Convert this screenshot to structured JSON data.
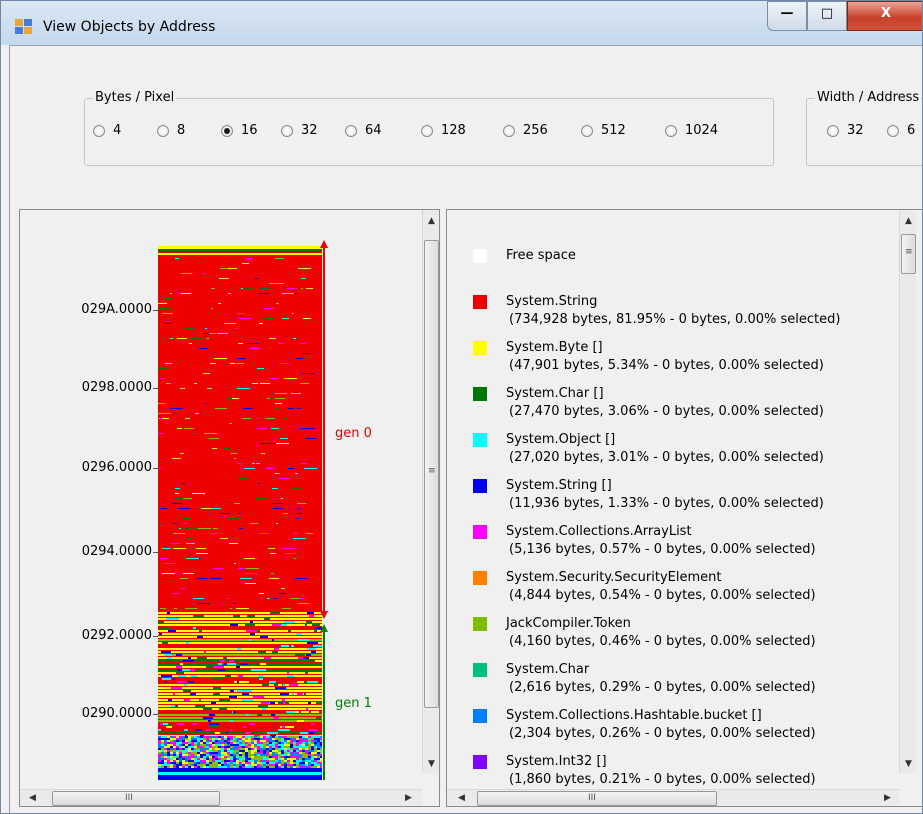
{
  "window": {
    "title": "View Objects by Address",
    "minimize": "—",
    "maximize": "□",
    "close": "X"
  },
  "bytes_per_pixel": {
    "title": "Bytes / Pixel",
    "options": [
      "4",
      "8",
      "16",
      "32",
      "64",
      "128",
      "256",
      "512",
      "1024"
    ],
    "selected": "16"
  },
  "width_address": {
    "title": "Width / Address",
    "options": [
      "32",
      "6"
    ]
  },
  "map": {
    "addresses": [
      "029A.0000",
      "0298.0000",
      "0296.0000",
      "0294.0000",
      "0292.0000",
      "0290.0000"
    ],
    "gen0": {
      "label": "gen 0",
      "color": "#ee0000"
    },
    "gen1": {
      "label": "gen 1",
      "color": "#008000"
    }
  },
  "legend": [
    {
      "name": "Free space",
      "detail": "",
      "color": "#ffffff"
    },
    {
      "name": "System.String",
      "detail": "(734,928 bytes, 81.95% - 0 bytes, 0.00% selected)",
      "color": "#ee0000"
    },
    {
      "name": "System.Byte []",
      "detail": "(47,901 bytes, 5.34% - 0 bytes, 0.00% selected)",
      "color": "#ffff00"
    },
    {
      "name": "System.Char []",
      "detail": "(27,470 bytes, 3.06% - 0 bytes, 0.00% selected)",
      "color": "#007800"
    },
    {
      "name": "System.Object []",
      "detail": "(27,020 bytes, 3.01% - 0 bytes, 0.00% selected)",
      "color": "#00ffff"
    },
    {
      "name": "System.String []",
      "detail": "(11,936 bytes, 1.33% - 0 bytes, 0.00% selected)",
      "color": "#0000ee"
    },
    {
      "name": "System.Collections.ArrayList",
      "detail": "(5,136 bytes, 0.57% - 0 bytes, 0.00% selected)",
      "color": "#ff00ff"
    },
    {
      "name": "System.Security.SecurityElement",
      "detail": "(4,844 bytes, 0.54% - 0 bytes, 0.00% selected)",
      "color": "#ff7f00"
    },
    {
      "name": "JackCompiler.Token",
      "detail": "(4,160 bytes, 0.46% - 0 bytes, 0.00% selected)",
      "color": "#7fbf00"
    },
    {
      "name": "System.Char",
      "detail": "(2,616 bytes, 0.29% - 0 bytes, 0.00% selected)",
      "color": "#00bf7f"
    },
    {
      "name": "System.Collections.Hashtable.bucket []",
      "detail": "(2,304 bytes, 0.26% - 0 bytes, 0.00% selected)",
      "color": "#007fff"
    },
    {
      "name": "System.Int32 []",
      "detail": "(1,860 bytes, 0.21% - 0 bytes, 0.00% selected)",
      "color": "#7f00ff"
    }
  ],
  "icons": {
    "window_icon": "app-window-icon",
    "scroll_up": "▲",
    "scroll_down": "▼",
    "scroll_left": "◀",
    "scroll_right": "▶",
    "grip_v": "≡",
    "grip_h": "III"
  }
}
